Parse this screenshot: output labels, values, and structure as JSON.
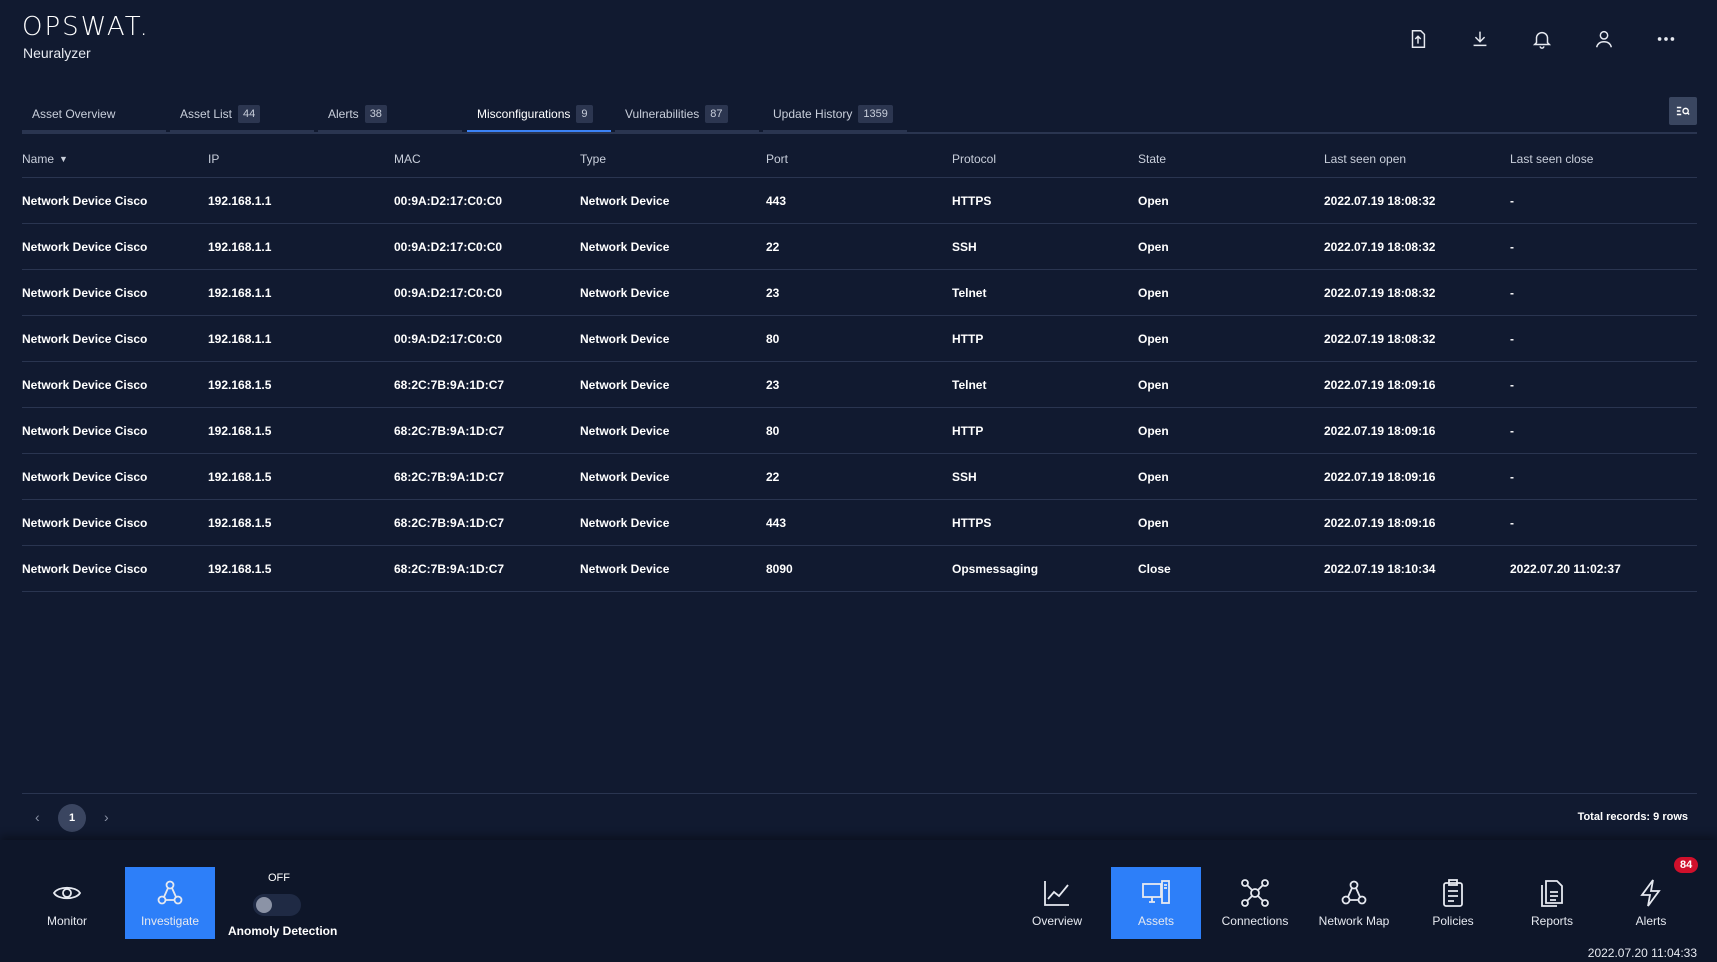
{
  "header": {
    "logo": "OPSWAT.",
    "product": "Neuralyzer",
    "icons": [
      "upload-file-icon",
      "download-icon",
      "bell-icon",
      "user-icon",
      "more-icon"
    ]
  },
  "tabs": [
    {
      "label": "Asset Overview",
      "count": ""
    },
    {
      "label": "Asset List",
      "count": "44"
    },
    {
      "label": "Alerts",
      "count": "38"
    },
    {
      "label": "Misconfigurations",
      "count": "9"
    },
    {
      "label": "Vulnerabilities",
      "count": "87"
    },
    {
      "label": "Update History",
      "count": "1359"
    }
  ],
  "active_tab": "Misconfigurations",
  "table": {
    "columns": [
      "Name",
      "IP",
      "MAC",
      "Type",
      "Port",
      "Protocol",
      "State",
      "Last seen open",
      "Last seen close"
    ],
    "rows": [
      [
        "Network Device Cisco",
        "192.168.1.1",
        "00:9A:D2:17:C0:C0",
        "Network Device",
        "443",
        "HTTPS",
        "Open",
        "2022.07.19 18:08:32",
        "-"
      ],
      [
        "Network Device Cisco",
        "192.168.1.1",
        "00:9A:D2:17:C0:C0",
        "Network Device",
        "22",
        "SSH",
        "Open",
        "2022.07.19 18:08:32",
        "-"
      ],
      [
        "Network Device Cisco",
        "192.168.1.1",
        "00:9A:D2:17:C0:C0",
        "Network Device",
        "23",
        "Telnet",
        "Open",
        "2022.07.19 18:08:32",
        "-"
      ],
      [
        "Network Device Cisco",
        "192.168.1.1",
        "00:9A:D2:17:C0:C0",
        "Network Device",
        "80",
        "HTTP",
        "Open",
        "2022.07.19 18:08:32",
        "-"
      ],
      [
        "Network Device Cisco",
        "192.168.1.5",
        "68:2C:7B:9A:1D:C7",
        "Network Device",
        "23",
        "Telnet",
        "Open",
        "2022.07.19 18:09:16",
        "-"
      ],
      [
        "Network Device Cisco",
        "192.168.1.5",
        "68:2C:7B:9A:1D:C7",
        "Network Device",
        "80",
        "HTTP",
        "Open",
        "2022.07.19 18:09:16",
        "-"
      ],
      [
        "Network Device Cisco",
        "192.168.1.5",
        "68:2C:7B:9A:1D:C7",
        "Network Device",
        "22",
        "SSH",
        "Open",
        "2022.07.19 18:09:16",
        "-"
      ],
      [
        "Network Device Cisco",
        "192.168.1.5",
        "68:2C:7B:9A:1D:C7",
        "Network Device",
        "443",
        "HTTPS",
        "Open",
        "2022.07.19 18:09:16",
        "-"
      ],
      [
        "Network Device Cisco",
        "192.168.1.5",
        "68:2C:7B:9A:1D:C7",
        "Network Device",
        "8090",
        "Opsmessaging",
        "Close",
        "2022.07.19 18:10:34",
        "2022.07.20 11:02:37"
      ]
    ]
  },
  "pagination": {
    "prev": "‹",
    "page": "1",
    "next": "›",
    "total": "Total records: 9 rows"
  },
  "bottom_nav": {
    "monitor": "Monitor",
    "investigate": "Investigate",
    "toggle_state": "OFF",
    "anomaly": "Anomoly Detection",
    "overview": "Overview",
    "assets": "Assets",
    "connections": "Connections",
    "network_map": "Network Map",
    "policies": "Policies",
    "reports": "Reports",
    "alerts": "Alerts",
    "alerts_badge": "84"
  },
  "clock": "2022.07.20 11:04:33",
  "colors": {
    "background": "#111a30",
    "active_nav": "#2d7ff9",
    "active_tab_underline": "#3b82f6",
    "badge": "#d0102b"
  }
}
